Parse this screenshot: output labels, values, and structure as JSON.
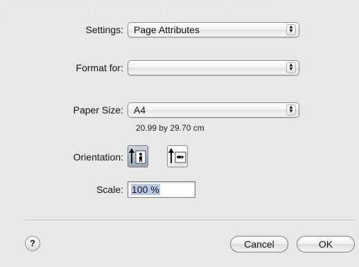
{
  "settings": {
    "label": "Settings:",
    "value": "Page Attributes"
  },
  "format_for": {
    "label": "Format for:",
    "value": ""
  },
  "paper_size": {
    "label": "Paper Size:",
    "value": "A4",
    "dimensions": "20.99 by 29.70 cm"
  },
  "orientation": {
    "label": "Orientation:",
    "options": [
      {
        "name": "portrait",
        "selected": true
      },
      {
        "name": "landscape",
        "selected": false
      }
    ]
  },
  "scale": {
    "label": "Scale:",
    "value": "100 %"
  },
  "buttons": {
    "help": "?",
    "cancel": "Cancel",
    "ok": "OK"
  },
  "popup_arrows": {
    "up": "▲",
    "down": "▼"
  }
}
